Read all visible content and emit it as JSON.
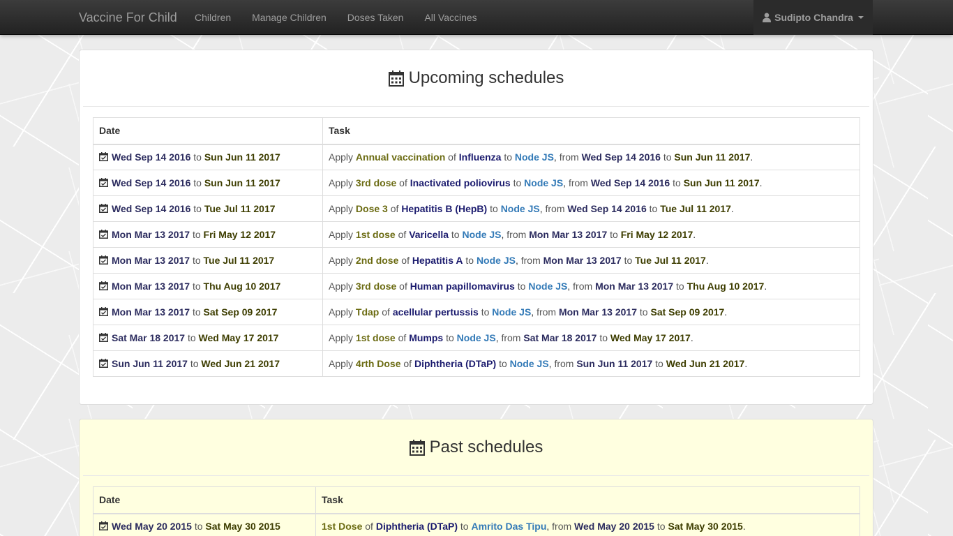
{
  "navbar": {
    "brand": "Vaccine For Child",
    "links": [
      "Children",
      "Manage Children",
      "Doses Taken",
      "All Vaccines"
    ],
    "user": "Sudipto Chandra",
    "icons": {
      "user": "user-icon",
      "caret": "caret-down-icon"
    }
  },
  "upcoming": {
    "title": "Upcoming schedules",
    "columns": {
      "date": "Date",
      "task": "Task"
    },
    "words": {
      "to": "to",
      "apply": "Apply",
      "of": "of",
      "from": "from"
    },
    "rows": [
      {
        "start": "Wed Sep 14 2016",
        "end": "Sun Jun 11 2017",
        "dose": "Annual vaccination",
        "vaccine": "Influenza",
        "child": "Node JS"
      },
      {
        "start": "Wed Sep 14 2016",
        "end": "Sun Jun 11 2017",
        "dose": "3rd dose",
        "vaccine": "Inactivated poliovirus",
        "child": "Node JS"
      },
      {
        "start": "Wed Sep 14 2016",
        "end": "Tue Jul 11 2017",
        "dose": "Dose 3",
        "vaccine": "Hepatitis B (HepB)",
        "child": "Node JS"
      },
      {
        "start": "Mon Mar 13 2017",
        "end": "Fri May 12 2017",
        "dose": "1st dose",
        "vaccine": "Varicella",
        "child": "Node JS"
      },
      {
        "start": "Mon Mar 13 2017",
        "end": "Tue Jul 11 2017",
        "dose": "2nd dose",
        "vaccine": "Hepatitis A",
        "child": "Node JS"
      },
      {
        "start": "Mon Mar 13 2017",
        "end": "Thu Aug 10 2017",
        "dose": "3rd dose",
        "vaccine": "Human papillomavirus",
        "child": "Node JS"
      },
      {
        "start": "Mon Mar 13 2017",
        "end": "Sat Sep 09 2017",
        "dose": "Tdap",
        "vaccine": "acellular pertussis",
        "child": "Node JS"
      },
      {
        "start": "Sat Mar 18 2017",
        "end": "Wed May 17 2017",
        "dose": "1st dose",
        "vaccine": "Mumps",
        "child": "Node JS"
      },
      {
        "start": "Sun Jun 11 2017",
        "end": "Wed Jun 21 2017",
        "dose": "4rth Dose",
        "vaccine": "Diphtheria (DTaP)",
        "child": "Node JS"
      }
    ]
  },
  "past": {
    "title": "Past schedules",
    "columns": {
      "date": "Date",
      "task": "Task"
    },
    "rows": [
      {
        "start": "Wed May 20 2015",
        "end": "Sat May 30 2015",
        "dose": "1st Dose",
        "vaccine": "Diphtheria (DTaP)",
        "child": "Amrito Das Tipu"
      }
    ]
  },
  "colors": {
    "navbar": "#222222",
    "link": "#337ab7",
    "past_panel_bg": "#ffffe0"
  }
}
